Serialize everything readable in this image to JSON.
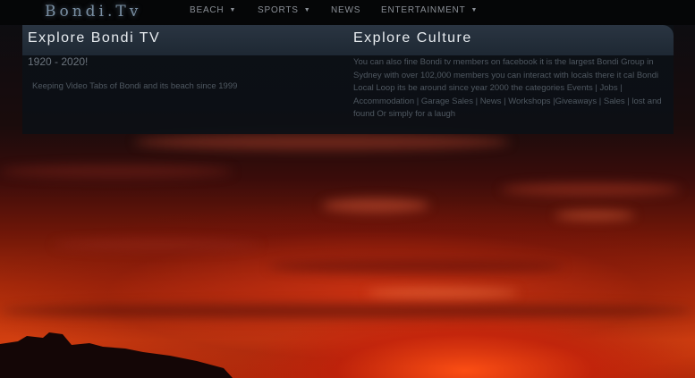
{
  "nav": {
    "logo": "Bondi.Tv",
    "items": [
      {
        "label": "BEACH",
        "has_dropdown": true
      },
      {
        "label": "SPORTS",
        "has_dropdown": true
      },
      {
        "label": "NEWS",
        "has_dropdown": false
      },
      {
        "label": "ENTERTAINMENT",
        "has_dropdown": true
      }
    ]
  },
  "left": {
    "heading": "Explore Bondi TV",
    "years": "1920 - 2020!",
    "tagline": "Keeping  Video Tabs of Bondi and its beach since 1999"
  },
  "right": {
    "heading": "Explore  Culture",
    "text": "You can also fine Bondi tv members on facebook it is the largest Bondi Group in Sydney with over 102,000 members you can interact with locals there it cal Bondi Local Loop its be around since year 2000 the categories Events | Jobs | Accommodation | Garage Sales | News | Workshops |Giveaways | Sales | lost and found Or simply for a laugh"
  },
  "colors": {
    "navbar": "#050607",
    "panel": "#0c1016",
    "heading_text": "#e8ecf0",
    "muted_text": "#4f5861"
  }
}
